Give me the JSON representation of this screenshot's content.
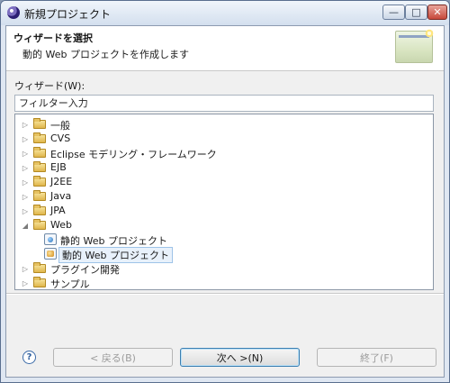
{
  "window": {
    "title": "新規プロジェクト"
  },
  "banner": {
    "title": "ウィザードを選択",
    "subtitle": "動的 Web プロジェクトを作成します"
  },
  "wizards": {
    "label": "ウィザード(W):",
    "filter_placeholder": "フィルター入力",
    "tree": [
      {
        "label": "一般",
        "expanded": false
      },
      {
        "label": "CVS",
        "expanded": false
      },
      {
        "label": "Eclipse モデリング・フレームワーク",
        "expanded": false
      },
      {
        "label": "EJB",
        "expanded": false
      },
      {
        "label": "J2EE",
        "expanded": false
      },
      {
        "label": "Java",
        "expanded": false
      },
      {
        "label": "JPA",
        "expanded": false
      },
      {
        "label": "Web",
        "expanded": true,
        "children": [
          {
            "label": "静的 Web プロジェクト",
            "icon": "static-web-project-icon"
          },
          {
            "label": "動的 Web プロジェクト",
            "icon": "dynamic-web-project-icon",
            "selected": true
          }
        ]
      },
      {
        "label": "プラグイン開発",
        "expanded": false
      },
      {
        "label": "サンプル",
        "expanded": false
      }
    ]
  },
  "buttons": {
    "help": "?",
    "back": "< 戻る(B)",
    "next": "次へ >(N)",
    "finish": "終了(F)"
  },
  "window_controls": {
    "minimize": "—",
    "maximize": "□",
    "close": "✕"
  }
}
